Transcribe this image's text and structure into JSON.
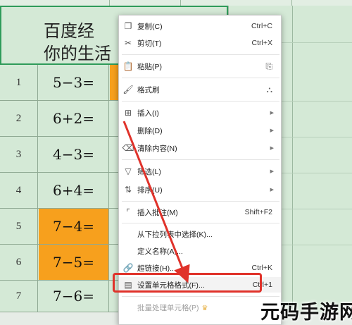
{
  "sheet": {
    "title_line1": "百度经",
    "title_line2": "你的生活",
    "rows": [
      {
        "num": "1",
        "expr": "5−3=",
        "highlight": false
      },
      {
        "num": "2",
        "expr": "6+2=",
        "highlight": false
      },
      {
        "num": "3",
        "expr": "4−3=",
        "highlight": false
      },
      {
        "num": "4",
        "expr": "6+4=",
        "highlight": false
      },
      {
        "num": "5",
        "expr": "7−4=",
        "highlight": true
      },
      {
        "num": "6",
        "expr": "7−5=",
        "highlight": true
      },
      {
        "num": "7",
        "expr": "7−6=",
        "highlight": false
      }
    ],
    "highlight_color": "#f7a01d"
  },
  "context_menu": {
    "copy": {
      "label": "复制(C)",
      "shortcut": "Ctrl+C",
      "icon": "copy-icon"
    },
    "cut": {
      "label": "剪切(T)",
      "shortcut": "Ctrl+X",
      "icon": "scissors-icon"
    },
    "paste": {
      "label": "粘贴(P)",
      "icon": "paste-icon"
    },
    "format_painter": {
      "label": "格式刷",
      "icon": "brush-icon"
    },
    "insert": {
      "label": "插入(I)",
      "icon": "insert-icon"
    },
    "delete": {
      "label": "删除(D)"
    },
    "clear": {
      "label": "清除内容(N)",
      "icon": "eraser-icon"
    },
    "filter": {
      "label": "筛选(L)",
      "icon": "filter-icon"
    },
    "sort": {
      "label": "排序(U)",
      "icon": "sort-icon"
    },
    "comment": {
      "label": "插入批注(M)",
      "shortcut": "Shift+F2",
      "icon": "comment-icon"
    },
    "dropdown_pick": {
      "label": "从下拉列表中选择(K)..."
    },
    "define_name": {
      "label": "定义名称(A)..."
    },
    "hyperlink": {
      "label": "超链接(H)...",
      "shortcut": "Ctrl+K",
      "icon": "link-icon"
    },
    "format_cells": {
      "label": "设置单元格格式(F)...",
      "shortcut": "Ctrl+1",
      "icon": "format-cells-icon"
    },
    "batch": {
      "label": "批量处理单元格(P)",
      "icon": "batch-icon"
    }
  },
  "annotation_color": "#e0322a",
  "watermark": "元码手游网"
}
